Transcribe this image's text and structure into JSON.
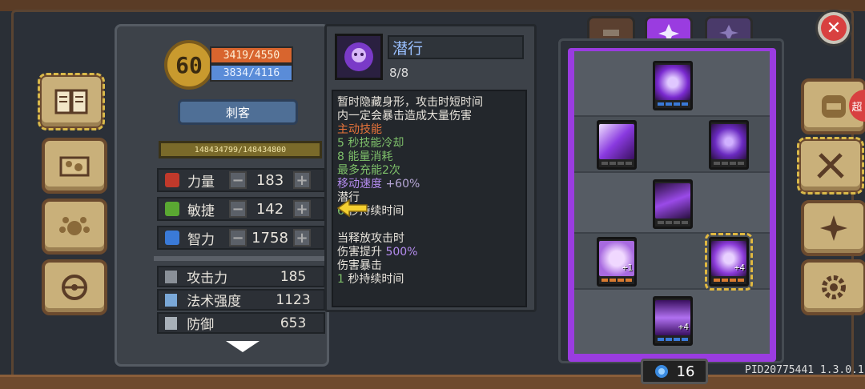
{
  "player": {
    "level": "60",
    "hp": "3419/4550",
    "mp": "3834/4116",
    "class_name": "刺客",
    "exp": "148434799/148434800"
  },
  "stats": [
    {
      "name": "力量",
      "value": "183",
      "icon": "fist-icon",
      "color": "#c0392b"
    },
    {
      "name": "敏捷",
      "value": "142",
      "icon": "feather-icon",
      "color": "#5aa832"
    },
    {
      "name": "智力",
      "value": "1758",
      "icon": "book-icon",
      "color": "#3a7ad8"
    }
  ],
  "attributes": [
    {
      "name": "攻击力",
      "value": "185",
      "icon": "sword-icon"
    },
    {
      "name": "法术强度",
      "value": "1123",
      "icon": "wand-icon"
    },
    {
      "name": "防御",
      "value": "653",
      "icon": "shield-icon"
    }
  ],
  "tooltip": {
    "skill_name": "潜行",
    "count": "8/8",
    "desc1": "暂时隐藏身形，攻击时短时间",
    "desc2": "内一定会暴击造成大量伤害",
    "active": "主动技能",
    "cooldown_num": "5",
    "cooldown": " 秒技能冷却",
    "energy_num": "8",
    "energy": " 能量消耗",
    "charges": "最多充能2次",
    "speed_label": "移动速度 ",
    "speed_val": "+60%",
    "stealth": "潜行",
    "stealth_num": "6",
    "stealth_dur": " 秒持续时间",
    "on_attack": "当释放攻击时",
    "dmg_label": "伤害提升 ",
    "dmg_val": "500%",
    "crit": "伤害暴击",
    "crit_num": "1",
    "crit_dur": " 秒持续时间"
  },
  "skill_points": "16",
  "version": "PID20775441 1.3.0.1",
  "right_bubble": "超",
  "nodes": [
    {
      "level": ""
    },
    {
      "level": ""
    },
    {
      "level": ""
    },
    {
      "level": ""
    },
    {
      "level": "+1"
    },
    {
      "level": "+4"
    },
    {
      "level": "+4"
    }
  ],
  "colors": {
    "accent_purple": "#9a3ce0",
    "hp_orange": "#d8652e",
    "mp_blue": "#5a8cd8"
  }
}
